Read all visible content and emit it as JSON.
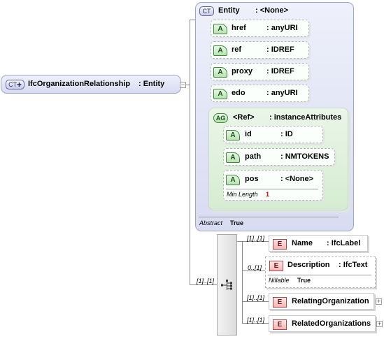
{
  "root": {
    "badge": "CT",
    "name": "IfcOrganizationRelationship",
    "type": ": Entity"
  },
  "entity": {
    "badge": "CT",
    "name": "Entity",
    "type": ": <None>",
    "abstract_label": "Abstract",
    "abstract_value": "True",
    "attributes": [
      {
        "badge": "A",
        "name": "href",
        "type": ": anyURI"
      },
      {
        "badge": "A",
        "name": "ref",
        "type": ": IDREF"
      },
      {
        "badge": "A",
        "name": "proxy",
        "type": ": IDREF"
      },
      {
        "badge": "A",
        "name": "edo",
        "type": ": anyURI"
      }
    ],
    "group": {
      "badge": "AG",
      "name": "<Ref>",
      "type": ": instanceAttributes",
      "attributes": [
        {
          "badge": "A",
          "name": "id",
          "type": ": ID"
        },
        {
          "badge": "A",
          "name": "path",
          "type": ": NMTOKENS"
        },
        {
          "badge": "A",
          "name": "pos",
          "type": ": <None>",
          "facet_label": "Min Length",
          "facet_value": "1"
        }
      ]
    }
  },
  "sequence": {
    "multiplicity": "[1]..[1]",
    "elements": [
      {
        "badge": "E",
        "name": "Name",
        "type": ": IfcLabel",
        "multiplicity": "[1]..[1]"
      },
      {
        "badge": "E",
        "name": "Description",
        "type": ": IfcText",
        "multiplicity": "0..[1]",
        "facet_label": "Nillable",
        "facet_value": "True"
      },
      {
        "badge": "E",
        "name": "RelatingOrganization",
        "type": "",
        "multiplicity": "[1]..[1]"
      },
      {
        "badge": "E",
        "name": "RelatedOrganizations",
        "type": "",
        "multiplicity": "[1]..[1]"
      }
    ]
  },
  "icons": {
    "expand": "plus-icon",
    "collapse": "minus-icon",
    "sequence": "sequence-icon"
  }
}
